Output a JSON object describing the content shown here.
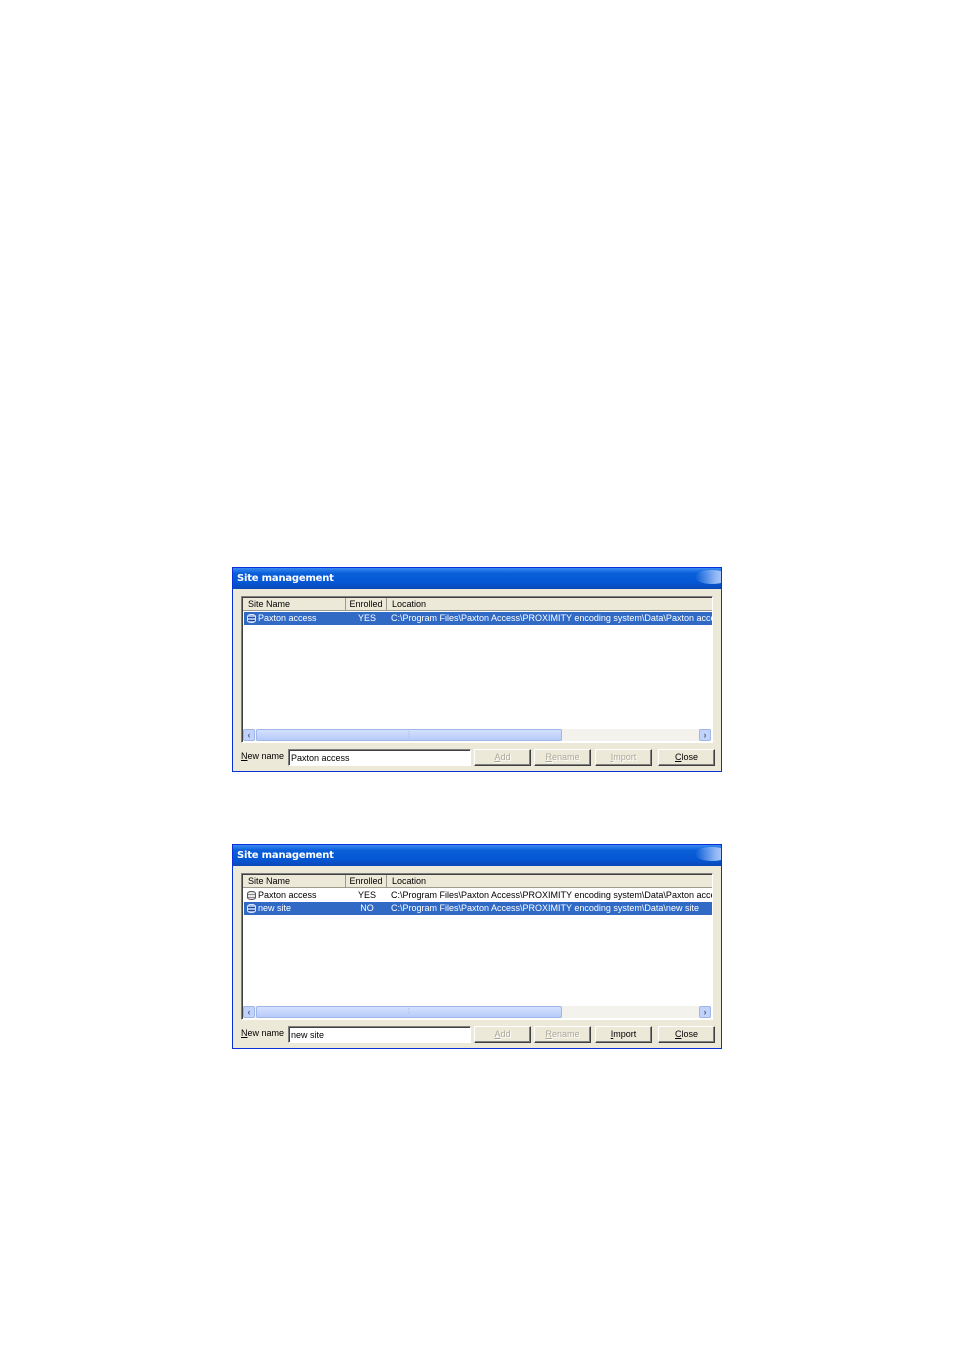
{
  "dialogs": [
    {
      "title": "Site management",
      "columns": {
        "name": "Site Name",
        "enrolled": "Enrolled",
        "location": "Location"
      },
      "rows": [
        {
          "icon": "database-icon",
          "name": "Paxton access",
          "enrolled": "YES",
          "location": "C:\\Program Files\\Paxton Access\\PROXIMITY encoding system\\Data\\Paxton access",
          "selected": true
        }
      ],
      "new_name_label": "New name",
      "new_name_value": "Paxton access",
      "buttons": {
        "add": {
          "label": "Add",
          "enabled": false
        },
        "rename": {
          "label": "Rename",
          "enabled": false
        },
        "import": {
          "label": "Import",
          "enabled": false
        },
        "close": {
          "label": "Close",
          "enabled": true
        }
      }
    },
    {
      "title": "Site management",
      "columns": {
        "name": "Site Name",
        "enrolled": "Enrolled",
        "location": "Location"
      },
      "rows": [
        {
          "icon": "database-icon",
          "name": "Paxton access",
          "enrolled": "YES",
          "location": "C:\\Program Files\\Paxton Access\\PROXIMITY encoding system\\Data\\Paxton access",
          "selected": false
        },
        {
          "icon": "database-icon",
          "name": "new site",
          "enrolled": "NO",
          "location": "C:\\Program Files\\Paxton Access\\PROXIMITY encoding system\\Data\\new site",
          "selected": true
        }
      ],
      "new_name_label": "New name",
      "new_name_value": "new site",
      "buttons": {
        "add": {
          "label": "Add",
          "enabled": false
        },
        "rename": {
          "label": "Rename",
          "enabled": false
        },
        "import": {
          "label": "Import",
          "enabled": true
        },
        "close": {
          "label": "Close",
          "enabled": true
        }
      }
    }
  ]
}
